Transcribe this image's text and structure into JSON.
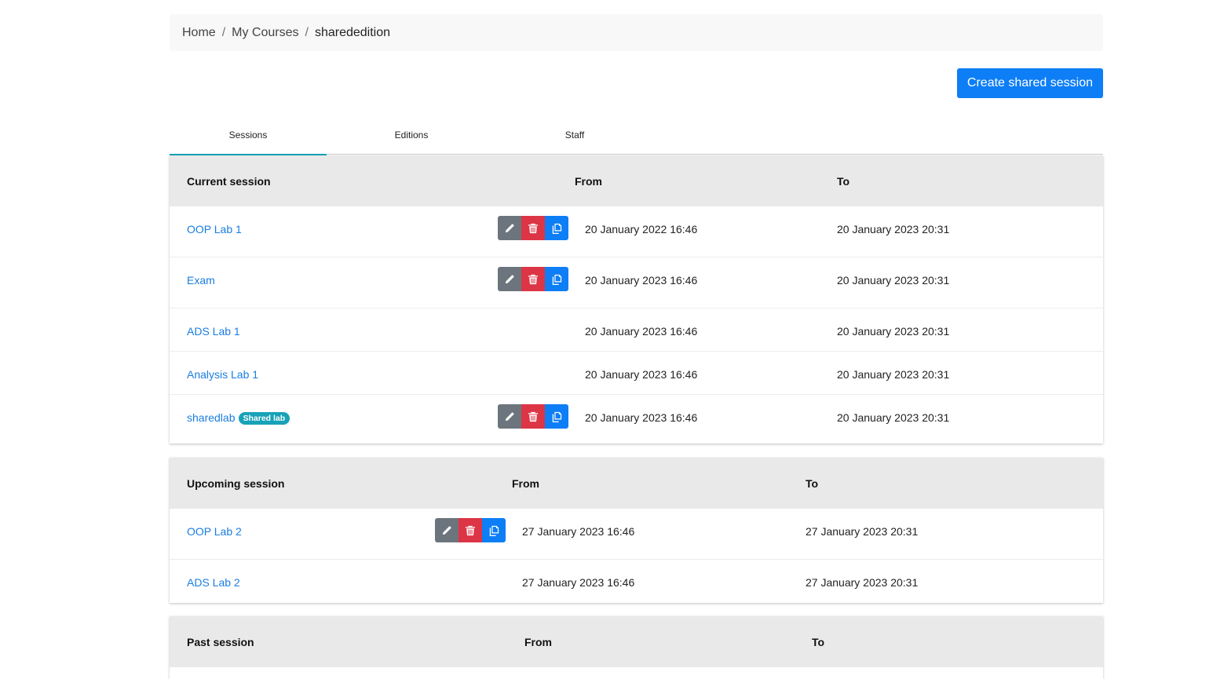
{
  "breadcrumb": [
    "Home",
    "My Courses",
    "sharededition"
  ],
  "breadcrumb_sep": "/",
  "create_button": "Create shared session",
  "tabs": [
    "Sessions",
    "Editions",
    "Staff"
  ],
  "colors": {
    "primary": "#0d7ef6",
    "danger": "#dc3545",
    "secondary": "#6c757d",
    "info": "#17a2b8"
  },
  "current": {
    "headers": {
      "name": "Current session",
      "from": "From",
      "to": "To"
    },
    "rows": [
      {
        "name": "OOP Lab 1",
        "from": "20 January 2022 16:46",
        "to": "20 January 2023 20:31",
        "actions": true
      },
      {
        "name": "Exam",
        "from": "20 January 2023 16:46",
        "to": "20 January 2023 20:31",
        "actions": true
      },
      {
        "name": "ADS Lab 1",
        "from": "20 January 2023 16:46",
        "to": "20 January 2023 20:31",
        "actions": false
      },
      {
        "name": "Analysis Lab 1",
        "from": "20 January 2023 16:46",
        "to": "20 January 2023 20:31",
        "actions": false
      },
      {
        "name": "sharedlab",
        "badge": "Shared lab",
        "from": "20 January 2023 16:46",
        "to": "20 January 2023 20:31",
        "actions": true
      }
    ]
  },
  "upcoming": {
    "headers": {
      "name": "Upcoming session",
      "from": "From",
      "to": "To"
    },
    "rows": [
      {
        "name": "OOP Lab 2",
        "from": "27 January 2023 16:46",
        "to": "27 January 2023 20:31",
        "actions": true
      },
      {
        "name": "ADS Lab 2",
        "from": "27 January 2023 16:46",
        "to": "27 January 2023 20:31",
        "actions": false
      }
    ]
  },
  "past": {
    "headers": {
      "name": "Past session",
      "from": "From",
      "to": "To"
    }
  },
  "icons": {
    "edit": "pencil-icon",
    "delete": "trash-icon",
    "copy": "copy-icon"
  }
}
